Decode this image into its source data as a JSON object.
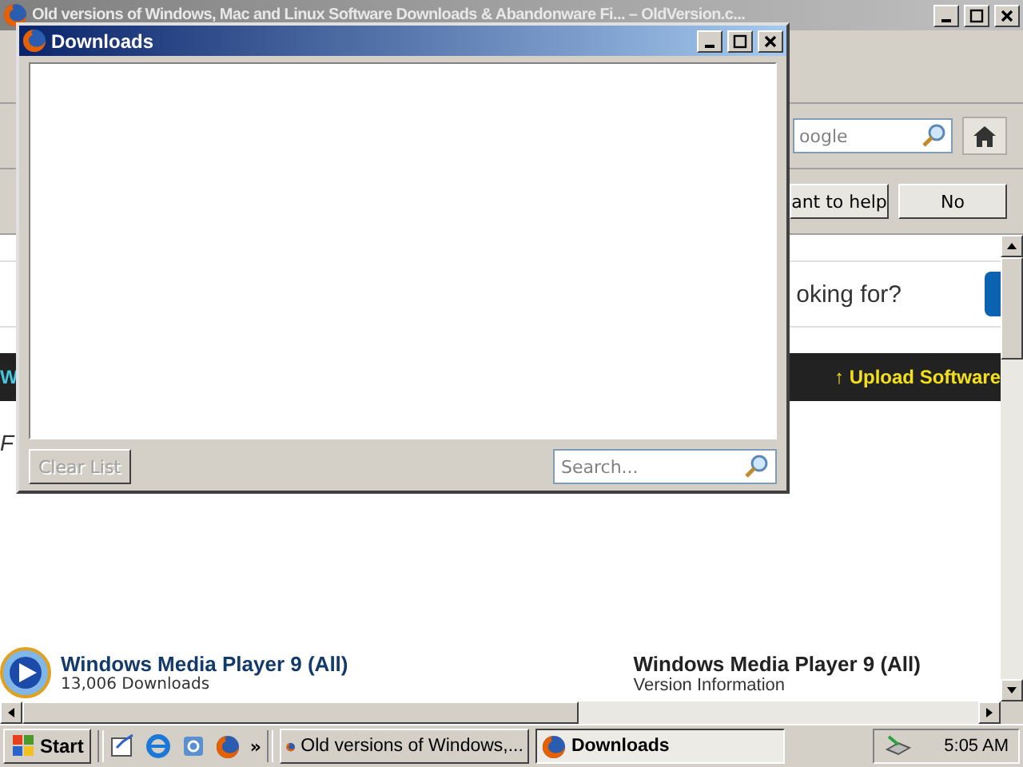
{
  "browser": {
    "title": "Old versions of Windows, Mac and Linux Software Downloads & Abandonware Fi... – OldVersion.c...",
    "search": {
      "placeholder": "oogle"
    },
    "notification": {
      "buttons": [
        "ant to help",
        "No"
      ]
    },
    "page": {
      "search_prompt": "oking for?",
      "banner_left": "W",
      "upload_link": "↑ Upload Software",
      "side_letter": "F",
      "listing": {
        "title": "Windows Media Player 9 (All)",
        "downloads": "13,006 Downloads"
      },
      "info": {
        "title": "Windows Media Player 9 (All)",
        "subtitle": "Version Information"
      }
    }
  },
  "downloads_window": {
    "title": "Downloads",
    "clear_button": {
      "label": "Clear List",
      "disabled": true
    },
    "search": {
      "placeholder": "Search..."
    }
  },
  "taskbar": {
    "start": "Start",
    "more": "»",
    "tasks": [
      {
        "label": "Old versions of Windows,...",
        "selected": false
      },
      {
        "label": "Downloads",
        "selected": true
      }
    ],
    "clock": "5:05 AM"
  }
}
